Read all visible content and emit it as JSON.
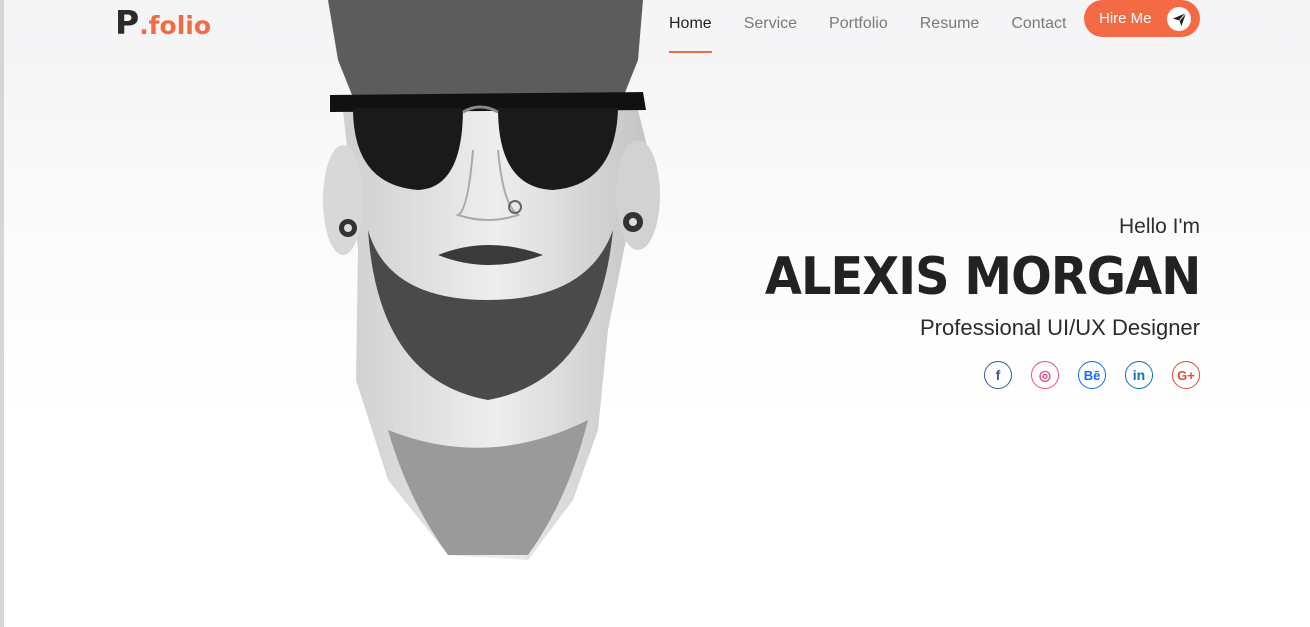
{
  "logo": {
    "letter": "P",
    "rest": ".folio"
  },
  "nav": [
    {
      "label": "Home"
    },
    {
      "label": "Service"
    },
    {
      "label": "Portfolio"
    },
    {
      "label": "Resume"
    },
    {
      "label": "Contact"
    }
  ],
  "hire": {
    "label": "Hire Me",
    "icon": "paper-plane-icon"
  },
  "hero": {
    "greeting": "Hello I'm",
    "name": "ALEXIS MORGAN",
    "role": "Professional UI/UX Designer"
  },
  "socials": [
    {
      "icon": "facebook-icon",
      "glyph": "f",
      "color": "#3b5998"
    },
    {
      "icon": "dribbble-icon",
      "glyph": "◎",
      "color": "#ea4c89"
    },
    {
      "icon": "behance-icon",
      "glyph": "Bē",
      "color": "#1769ff"
    },
    {
      "icon": "linkedin-icon",
      "glyph": "in",
      "color": "#0e76a8"
    },
    {
      "icon": "google-plus-icon",
      "glyph": "G+",
      "color": "#dd4b39"
    }
  ],
  "colors": {
    "accent": "#f46a45",
    "text": "#2b2b2b"
  }
}
